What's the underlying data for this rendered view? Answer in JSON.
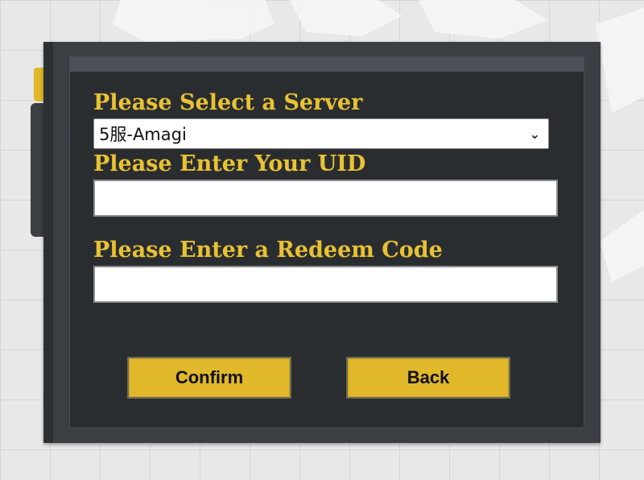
{
  "form": {
    "server_label": "Please Select a Server",
    "server_value": "5服-Amagi",
    "uid_label": "Please Enter Your UID",
    "uid_value": "",
    "code_label": "Please Enter a Redeem Code",
    "code_value": ""
  },
  "buttons": {
    "confirm_label": "Confirm",
    "back_label": "Back"
  },
  "colors": {
    "accent": "#e0b82a",
    "label_text": "#e8c233",
    "panel": "#2a2d30",
    "frame": "#3b3e43"
  },
  "icons": {
    "select_chevron": "chevron-down-icon"
  }
}
